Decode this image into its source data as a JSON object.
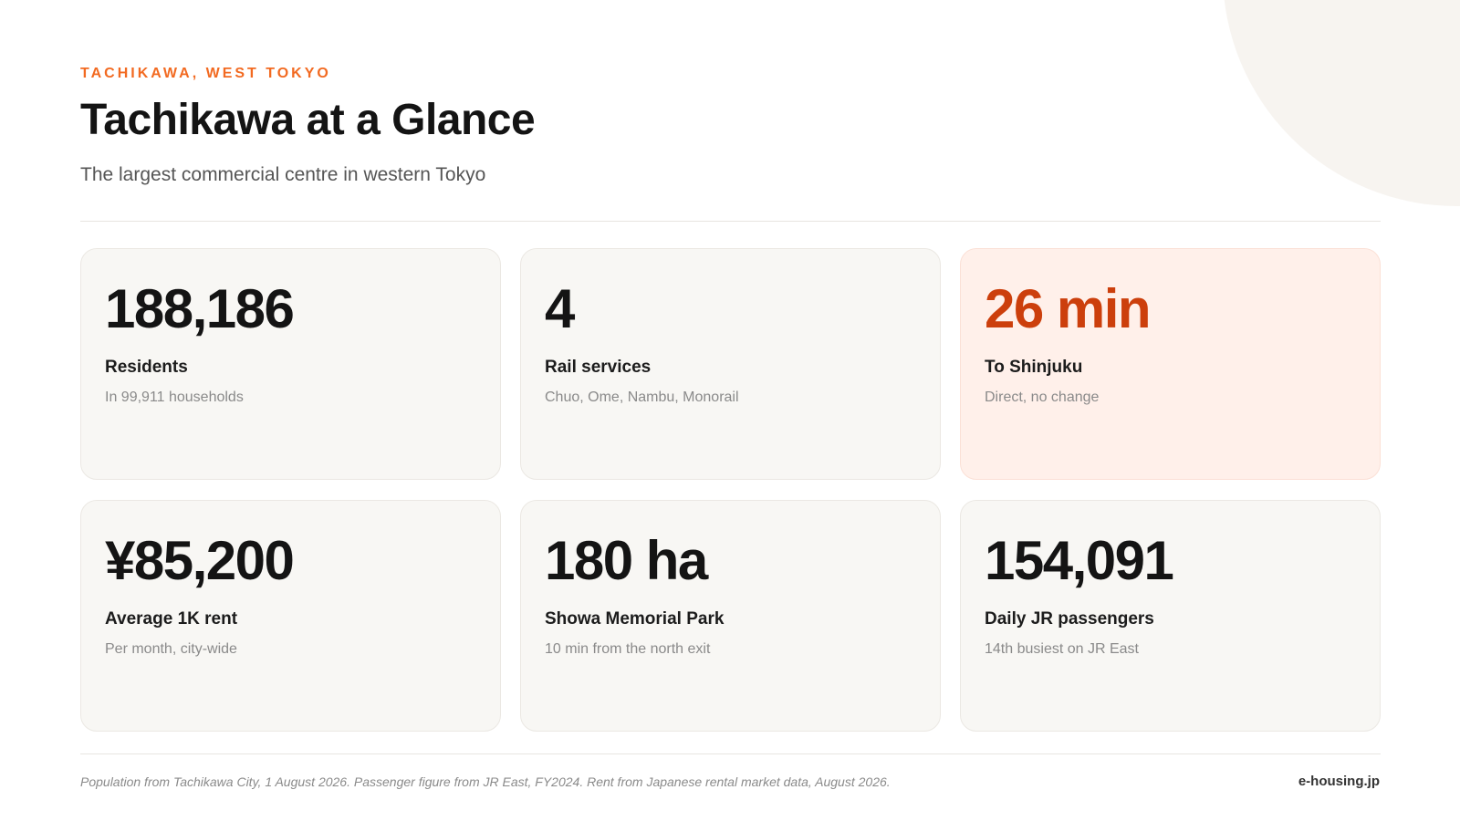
{
  "header": {
    "eyebrow": "TACHIKAWA, WEST TOKYO",
    "title": "Tachikawa at a Glance",
    "subtitle": "The largest commercial centre in western Tokyo"
  },
  "stats": [
    {
      "value": "188,186",
      "label": "Residents",
      "note": "In 99,911 households"
    },
    {
      "value": "4",
      "label": "Rail services",
      "note": "Chuo, Ome, Nambu, Monorail"
    },
    {
      "value": "26 min",
      "label": "To Shinjuku",
      "note": "Direct, no change"
    },
    {
      "value": "¥85,200",
      "label": "Average 1K rent",
      "note": "Per month, city-wide"
    },
    {
      "value": "180 ha",
      "label": "Showa Memorial Park",
      "note": "10 min from the north exit"
    },
    {
      "value": "154,091",
      "label": "Daily JR passengers",
      "note": "14th busiest on JR East"
    }
  ],
  "footer": {
    "source_note": "Population from Tachikawa City, 1 August 2026. Passenger figure from JR East, FY2024. Rent from Japanese rental market data, August 2026.",
    "brand": "e-housing.jp"
  },
  "colors": {
    "accent": "#f26a21",
    "highlight_value": "#cc3f0c",
    "highlight_card": "#fff0ea",
    "card": "#f8f7f4"
  }
}
